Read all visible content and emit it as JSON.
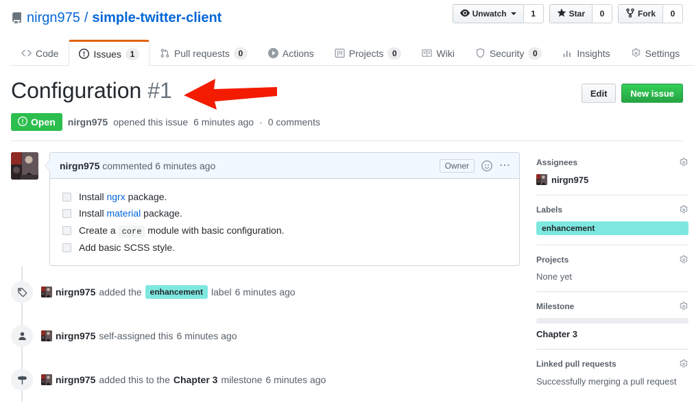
{
  "repo": {
    "owner": "nirgn975",
    "separator": "/",
    "name": "simple-twitter-client",
    "icon": "repo-book-icon"
  },
  "repo_actions": {
    "watch": {
      "label": "Unwatch",
      "count": "1",
      "icon": "eye-icon"
    },
    "star": {
      "label": "Star",
      "count": "0",
      "icon": "star-icon"
    },
    "fork": {
      "label": "Fork",
      "count": "0",
      "icon": "fork-icon"
    }
  },
  "tabs": [
    {
      "label": "Code",
      "icon": "code-icon",
      "count": null,
      "active": false
    },
    {
      "label": "Issues",
      "icon": "issue-opened-icon",
      "count": "1",
      "active": true
    },
    {
      "label": "Pull requests",
      "icon": "git-pull-request-icon",
      "count": "0",
      "active": false
    },
    {
      "label": "Actions",
      "icon": "play-icon",
      "count": null,
      "active": false
    },
    {
      "label": "Projects",
      "icon": "project-board-icon",
      "count": "0",
      "active": false
    },
    {
      "label": "Wiki",
      "icon": "book-icon",
      "count": null,
      "active": false
    },
    {
      "label": "Security",
      "icon": "shield-icon",
      "count": "0",
      "active": false
    },
    {
      "label": "Insights",
      "icon": "graph-icon",
      "count": null,
      "active": false
    },
    {
      "label": "Settings",
      "icon": "gear-icon",
      "count": null,
      "active": false
    }
  ],
  "issue": {
    "title": "Configuration",
    "number": "#1",
    "edit_label": "Edit",
    "new_issue_label": "New issue",
    "state": "Open",
    "state_color": "#2cbe4e",
    "meta_author": "nirgn975",
    "meta_action": "opened this issue",
    "meta_time": "6 minutes ago",
    "meta_separator": "·",
    "meta_comments": "0 comments"
  },
  "comment": {
    "author": "nirgn975",
    "action": "commented",
    "time": "6 minutes ago",
    "owner_badge": "Owner",
    "emoji_icon": "smiley-icon",
    "menu_icon": "kebab-horizontal-icon",
    "tasks": [
      {
        "checked": false,
        "prefix": "Install ",
        "link": "ngrx",
        "code": null,
        "suffix": " package."
      },
      {
        "checked": false,
        "prefix": "Install ",
        "link": "material",
        "code": null,
        "suffix": " package."
      },
      {
        "checked": false,
        "prefix": "Create a ",
        "link": null,
        "code": "core",
        "suffix": " module with basic configuration."
      },
      {
        "checked": false,
        "prefix": "Add basic SCSS style.",
        "link": null,
        "code": null,
        "suffix": ""
      }
    ]
  },
  "timeline": [
    {
      "icon": "tag-icon",
      "user": "nirgn975",
      "before": "added the",
      "label": "enhancement",
      "label_color": "#7ee8e0",
      "after": "label",
      "time": "6 minutes ago"
    },
    {
      "icon": "person-icon",
      "user": "nirgn975",
      "before": "self-assigned this",
      "label": null,
      "after": "",
      "time": "6 minutes ago"
    },
    {
      "icon": "milestone-icon",
      "user": "nirgn975",
      "before": "added this to the",
      "strong": "Chapter 3",
      "after": "milestone",
      "time": "6 minutes ago"
    }
  ],
  "sidebar": {
    "assignees": {
      "title": "Assignees",
      "gear": "gear-icon",
      "user": "nirgn975"
    },
    "labels": {
      "title": "Labels",
      "gear": "gear-icon",
      "value": "enhancement",
      "color": "#7ee8e0"
    },
    "projects": {
      "title": "Projects",
      "gear": "gear-icon",
      "value": "None yet"
    },
    "milestone": {
      "title": "Milestone",
      "gear": "gear-icon",
      "progress": "0",
      "value": "Chapter 3"
    },
    "linked_prs": {
      "title": "Linked pull requests",
      "gear": "gear-icon",
      "value": "Successfully merging a pull request"
    }
  },
  "annotation": {
    "arrow": "red-left-arrow",
    "color": "#f31b00"
  }
}
